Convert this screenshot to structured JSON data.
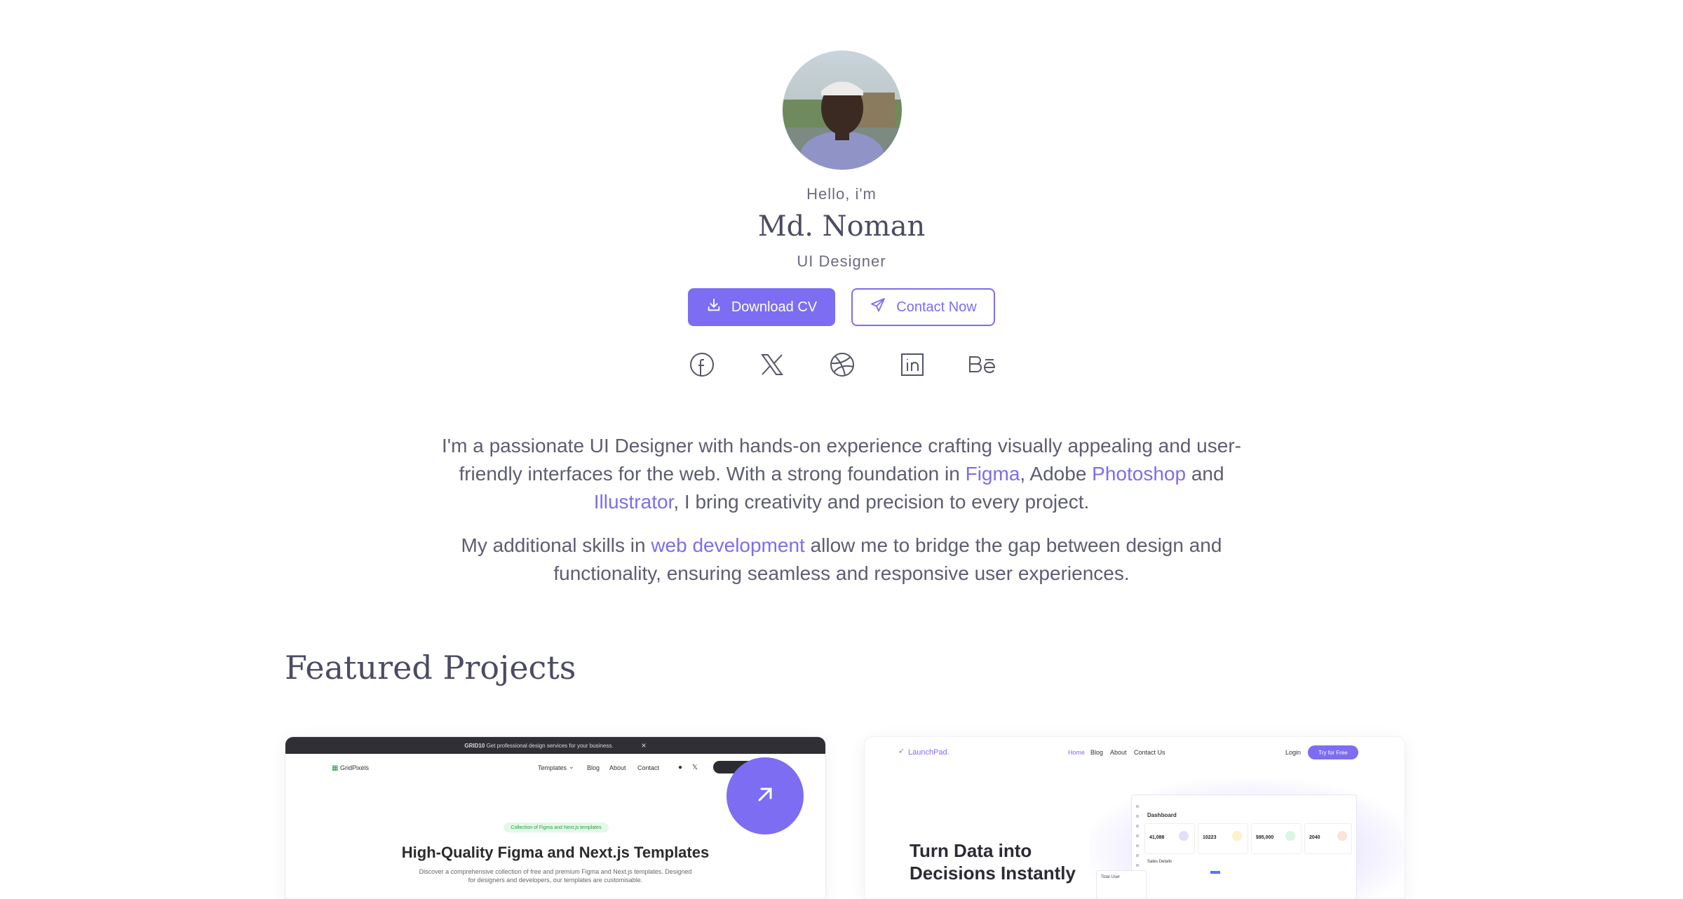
{
  "hero": {
    "greeting": "Hello, i'm",
    "name": "Md. Noman",
    "role": "UI Designer",
    "download_label": "Download CV",
    "contact_label": "Contact Now"
  },
  "socials": [
    "facebook-icon",
    "x-icon",
    "dribbble-icon",
    "linkedin-icon",
    "behance-icon"
  ],
  "bio": {
    "p1_a": "I'm a passionate UI Designer with hands-on experience crafting visually  appealing and user-",
    "p1_b": "friendly interfaces for the web. With a strong  foundation in ",
    "figma": "Figma",
    "p1_c": ", Adobe ",
    "photoshop": "Photoshop",
    "p1_d": " and",
    "illustrator": "Illustrator",
    "p1_e": ", I bring creativity and  precision to every project.",
    "p2_a": "My additional skills in ",
    "webdev": "web development",
    "p2_b": "  allow me to bridge the gap between design and",
    "p2_c": "functionality, ensuring  seamless and responsive user experiences."
  },
  "section_title": "Featured Projects",
  "project1": {
    "topbar_badge": "GRID10",
    "topbar_text": "Get professional design services for your business.",
    "close": "×",
    "brand": "GridPixels",
    "nav": [
      "Templates",
      "Blog",
      "About",
      "Contact"
    ],
    "pill": "Collection of Figma and Next.js templates",
    "title": "High-Quality Figma and Next.js Templates",
    "subtitle": "Discover a comprehensive collection of free and premium Figma and Next.js templates. Designed for designers and developers, our templates are customisable."
  },
  "project2": {
    "brand": "LaunchPad.",
    "nav": [
      "Home",
      "Blog",
      "About",
      "Contact Us"
    ],
    "login": "Login",
    "cta": "Try for Free",
    "headline_1": "Turn Data into",
    "headline_2": "Decisions Instantly",
    "dash_title": "Dashboard",
    "stats": [
      "41,088",
      "10223",
      "$95,000",
      "2040"
    ],
    "sales_label": "Sales Details",
    "total_user": "Total User"
  },
  "colors": {
    "accent": "#7c6df2",
    "text": "#5a5a72",
    "heading": "#4b4b63"
  }
}
